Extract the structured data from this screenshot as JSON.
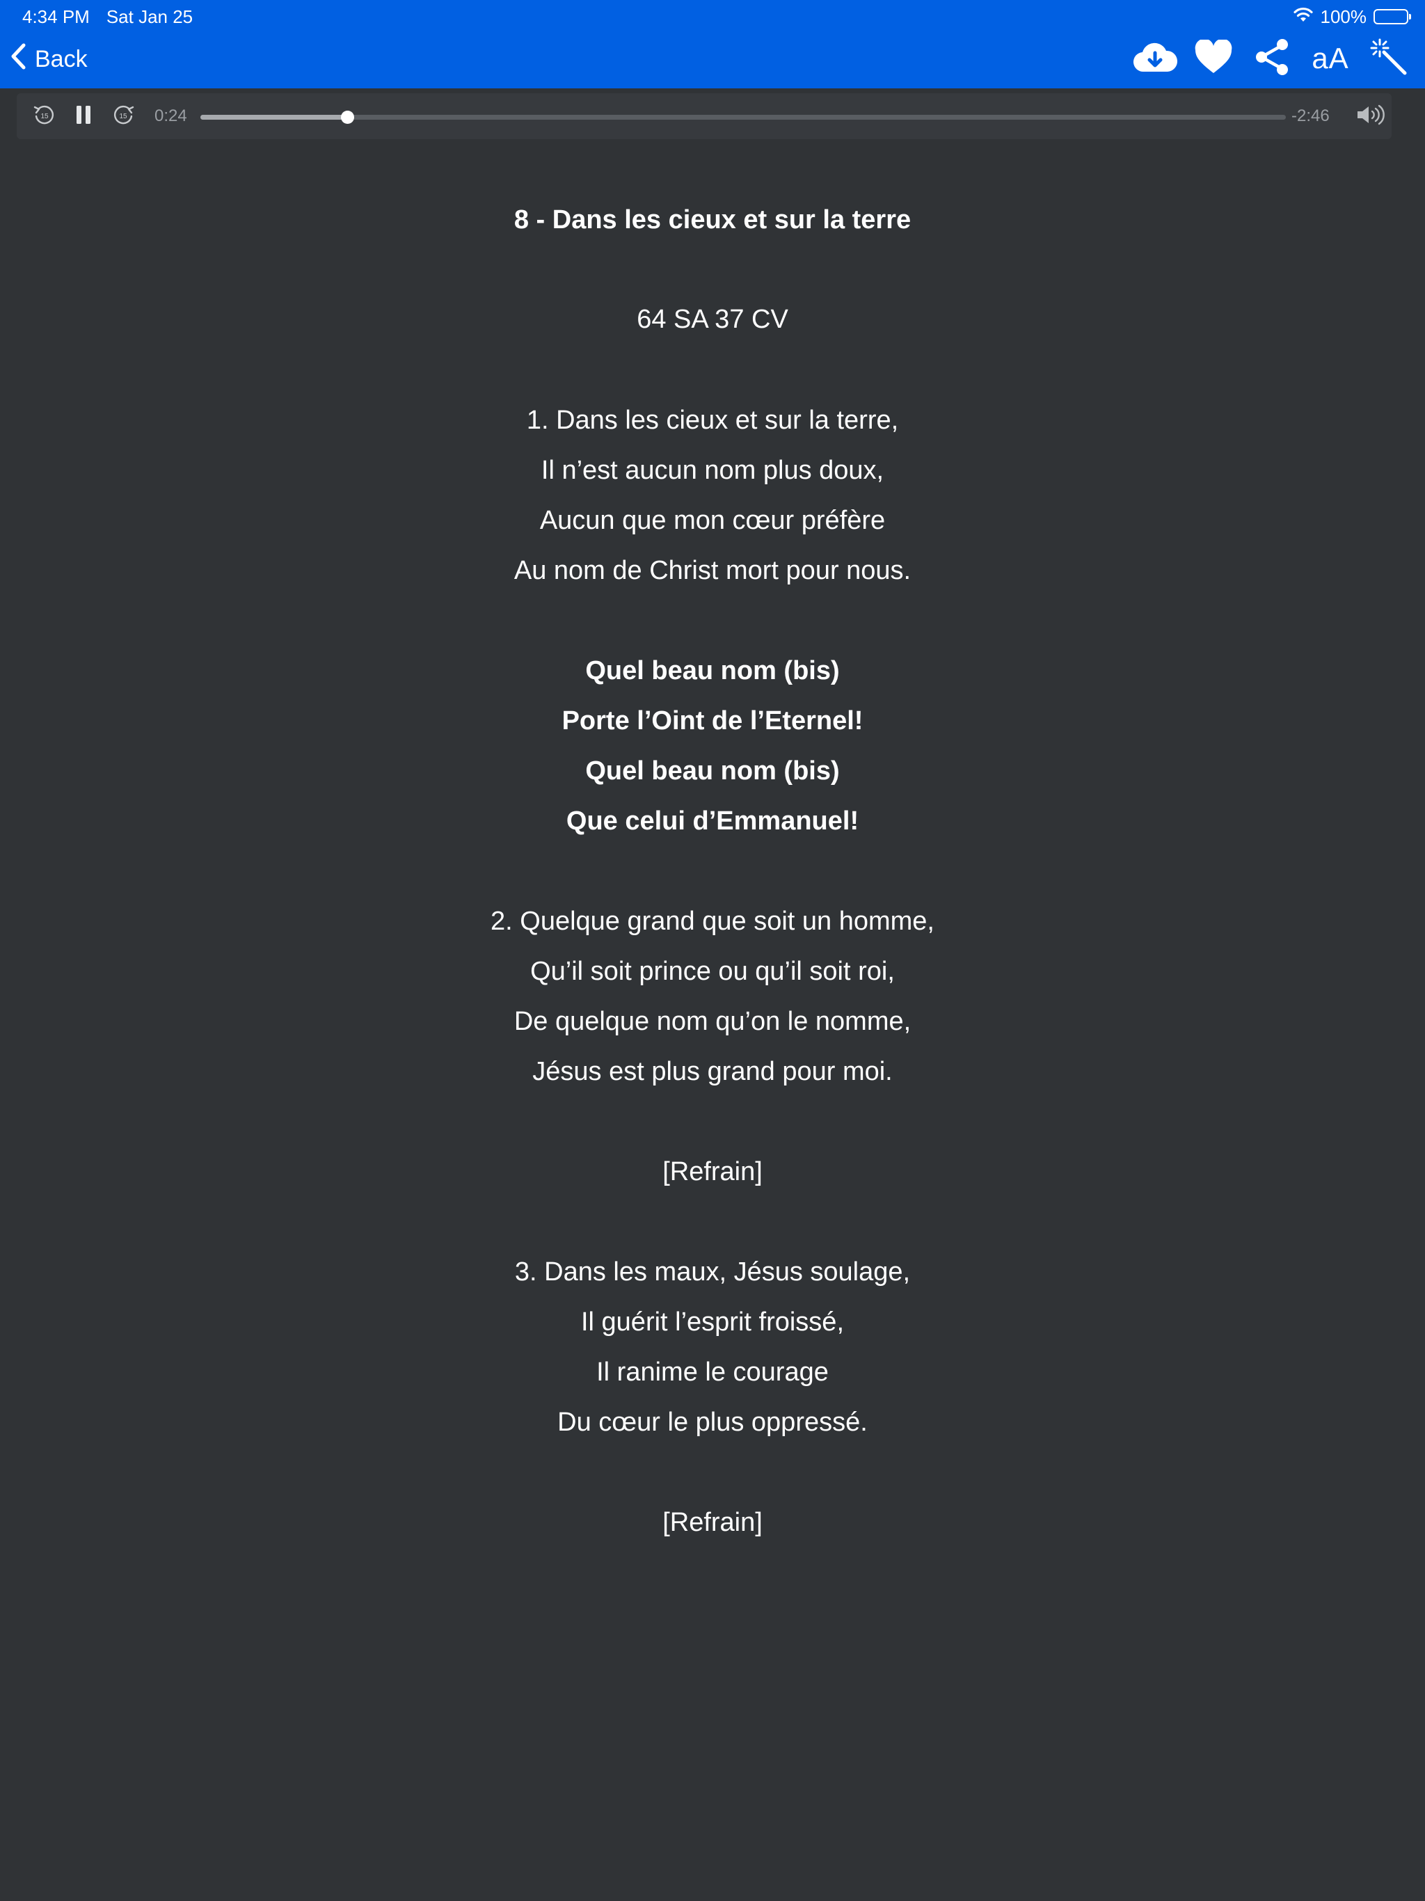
{
  "status_bar": {
    "time": "4:34 PM",
    "date": "Sat Jan 25",
    "battery": "100%"
  },
  "nav": {
    "back_label": "Back",
    "text_size_label": "aA",
    "icons": [
      "cloud-download-icon",
      "heart-icon",
      "share-icon",
      "text-size-icon",
      "magic-wand-icon"
    ]
  },
  "player": {
    "elapsed": "0:24",
    "remaining": "-2:46",
    "progress": 0.135
  },
  "hymn": {
    "title": "8 - Dans les cieux et sur la terre",
    "reference": "64 SA 37 CV",
    "stanza1": [
      "1. Dans les cieux et sur la terre,",
      "Il n’est aucun nom plus doux,",
      "Aucun que mon cœur préfère",
      "Au nom de Christ mort pour nous."
    ],
    "refrain": [
      "Quel beau nom (bis)",
      "Porte l’Oint de l’Eternel!",
      "Quel beau nom (bis)",
      "Que celui d’Emmanuel!"
    ],
    "stanza2": [
      "2. Quelque grand que soit un homme,",
      "Qu’il soit prince ou qu’il soit roi,",
      "De quelque nom qu’on le nomme,",
      "Jésus est plus grand pour moi."
    ],
    "refrain_marker_1": "[Refrain]",
    "stanza3": [
      "3. Dans les maux, Jésus soulage,",
      "Il guérit l’esprit froissé,",
      "Il ranime le courage",
      "Du cœur le plus oppressé."
    ],
    "refrain_marker_2": "[Refrain]"
  },
  "colors": {
    "header": "#0160E2",
    "background": "#303336",
    "player": "#373A3E",
    "text": "#FFFFFF"
  }
}
